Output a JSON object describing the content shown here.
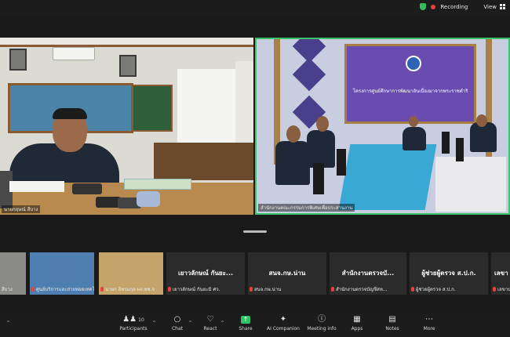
{
  "topbar": {
    "recording_label": "Recording",
    "view_label": "View",
    "colors": {
      "shield": "#2fbf5a",
      "record": "#e8413b"
    }
  },
  "main_tiles": [
    {
      "caption": "นายกฤษณ์ สีบาง",
      "speaking": false
    },
    {
      "caption": "สำนักงานคณะกรรมการพิเศษเพื่อประสานงาน",
      "speaking": true,
      "banner_text": "โครงการศูนย์ศึกษาการพัฒนาอันเนื่องมาจากพระราชดำริ"
    }
  ],
  "filmstrip": [
    {
      "caption": "สีบาง",
      "type": "video"
    },
    {
      "caption": "ศูนย์บริการและถ่ายทอดเทคโนโลยี",
      "type": "video"
    },
    {
      "caption": "นายก ลีพรมกุล ผอ.พช.จ",
      "type": "video"
    },
    {
      "name": "เยาวลักษณ์ กันยะ...",
      "caption": "เยาวลักษณ์ กันยะมิ ศว.",
      "type": "name"
    },
    {
      "name": "สนจ.กษ.น่าน",
      "caption": "สนจ.กษ.น่าน",
      "type": "name"
    },
    {
      "name": "สำนักงานตรวจบั...",
      "caption": "สำนักงานตรวจบัญชีสห...",
      "type": "name"
    },
    {
      "name": "ผู้ช่วยผู้ตรวจ ส.ป.ก.",
      "caption": "ผู้ช่วยผู้ตรวจ ส.ป.ก.",
      "type": "name"
    },
    {
      "name": "เลขา",
      "caption": "เลขานุการ",
      "type": "name"
    }
  ],
  "toolbar": {
    "participants_count": "10",
    "items": [
      {
        "label": "Participants",
        "icon": "participants-icon"
      },
      {
        "label": "Chat",
        "icon": "chat-icon"
      },
      {
        "label": "React",
        "icon": "heart-icon"
      },
      {
        "label": "Share",
        "icon": "share-icon"
      },
      {
        "label": "AI Companion",
        "icon": "sparkle-icon"
      },
      {
        "label": "Meeting info",
        "icon": "info-icon"
      },
      {
        "label": "Apps",
        "icon": "apps-icon"
      },
      {
        "label": "Notes",
        "icon": "notes-icon"
      },
      {
        "label": "More",
        "icon": "more-icon"
      }
    ],
    "share_color": "#2ec566"
  }
}
